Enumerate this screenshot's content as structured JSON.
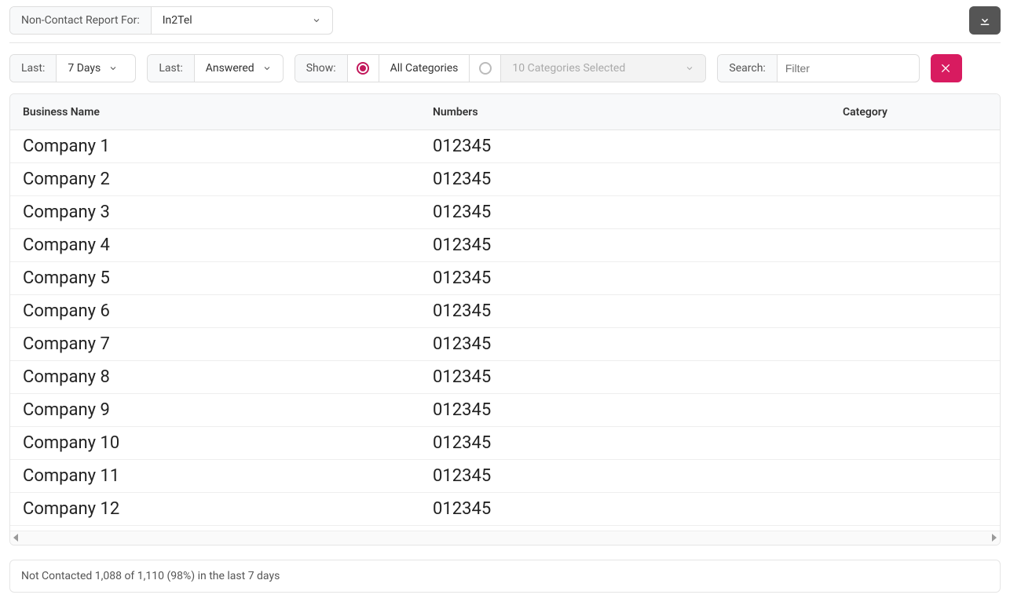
{
  "header": {
    "report_label": "Non-Contact Report For:",
    "report_value": "In2Tel"
  },
  "filters": {
    "last_period": {
      "label": "Last:",
      "value": "7 Days"
    },
    "last_status": {
      "label": "Last:",
      "value": "Answered"
    },
    "show": {
      "label": "Show:",
      "all_categories": "All Categories",
      "selected_count_text": "10 Categories Selected"
    },
    "search": {
      "label": "Search:",
      "placeholder": "Filter",
      "value": ""
    }
  },
  "table": {
    "columns": {
      "business": "Business Name",
      "numbers": "Numbers",
      "category": "Category"
    },
    "rows": [
      {
        "name": "Company 1",
        "numbers": "012345",
        "category": ""
      },
      {
        "name": "Company 2",
        "numbers": "012345",
        "category": ""
      },
      {
        "name": "Company 3",
        "numbers": "012345",
        "category": ""
      },
      {
        "name": "Company 4",
        "numbers": "012345",
        "category": ""
      },
      {
        "name": "Company 5",
        "numbers": "012345",
        "category": ""
      },
      {
        "name": "Company 6",
        "numbers": "012345",
        "category": ""
      },
      {
        "name": "Company 7",
        "numbers": "012345",
        "category": ""
      },
      {
        "name": "Company 8",
        "numbers": "012345",
        "category": ""
      },
      {
        "name": "Company 9",
        "numbers": "012345",
        "category": ""
      },
      {
        "name": "Company 10",
        "numbers": "012345",
        "category": ""
      },
      {
        "name": "Company 11",
        "numbers": "012345",
        "category": ""
      },
      {
        "name": "Company 12",
        "numbers": "012345",
        "category": ""
      }
    ]
  },
  "summary": "Not Contacted 1,088 of 1,110 (98%) in the last 7 days",
  "colors": {
    "accent": "#d81b60"
  }
}
